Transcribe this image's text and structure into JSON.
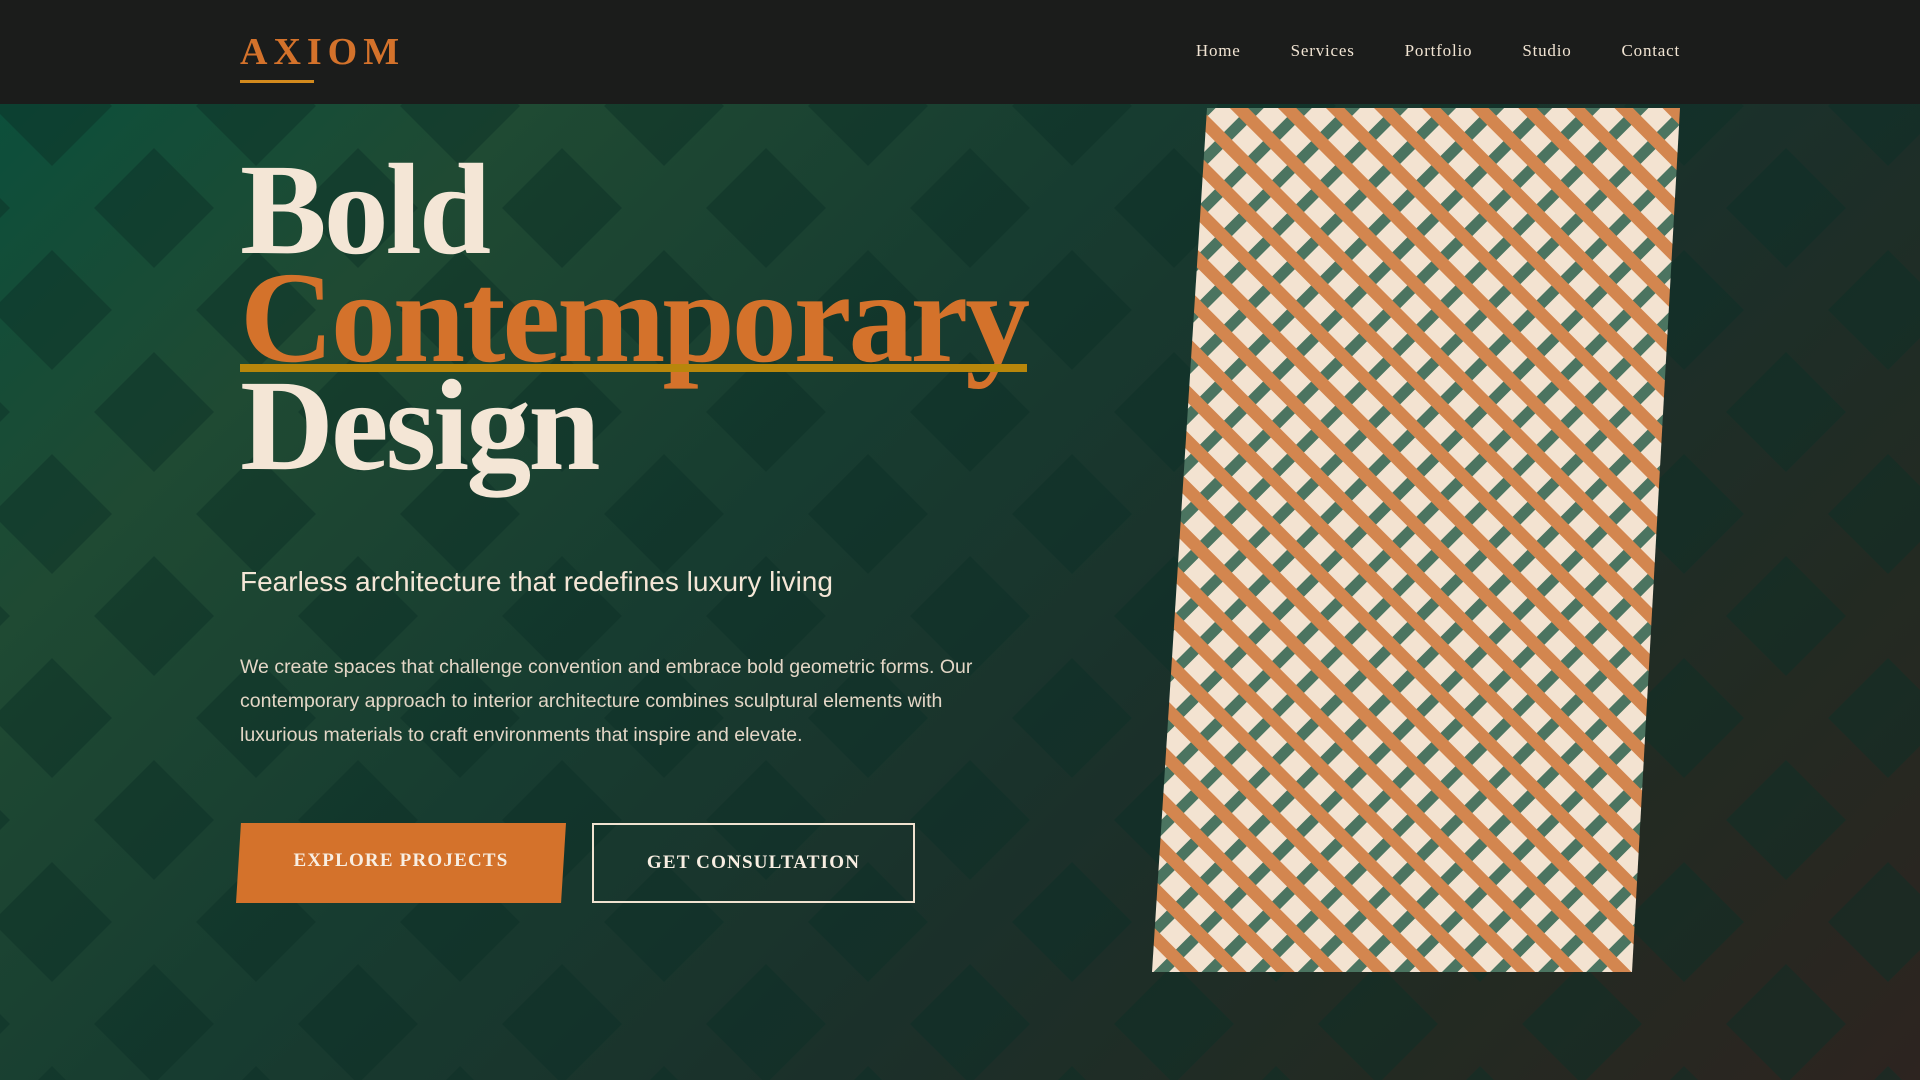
{
  "brand": {
    "logo": "AXIOM"
  },
  "nav": {
    "items": [
      "Home",
      "Services",
      "Portfolio",
      "Studio",
      "Contact"
    ]
  },
  "hero": {
    "headline": {
      "line1": "Bold",
      "line2": "Contemporary",
      "line3": "Design"
    },
    "subtitle": "Fearless architecture that redefines luxury living",
    "description": "We create spaces that challenge convention and embrace bold geometric forms. Our contemporary approach to interior architecture combines sculptural elements with luxurious materials to craft environments that inspire and elevate.",
    "primary_button": "EXPLORE PROJECTS",
    "secondary_button": "GET CONSULTATION"
  },
  "colors": {
    "background_dark": "#1b1c1b",
    "accent_orange": "#d4722b",
    "accent_gold": "#b8860b",
    "cream": "#f4e6d6",
    "deep_green": "#0c4f3b",
    "pattern_green": "#4b7460"
  },
  "icons": {
    "hero_art": "diagonal-lattice-pattern"
  }
}
